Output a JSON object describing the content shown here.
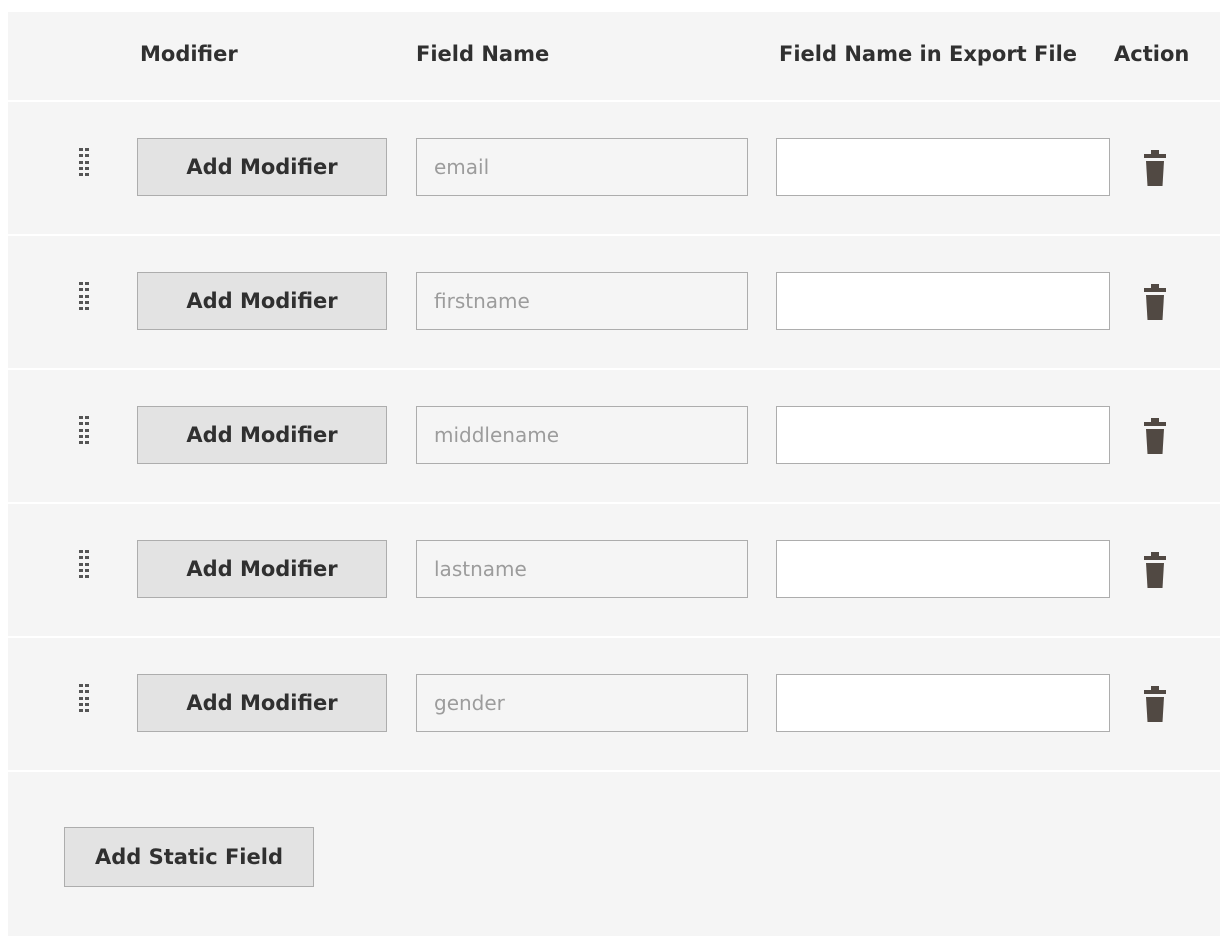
{
  "table": {
    "headers": {
      "modifier": "Modifier",
      "field_name": "Field Name",
      "export_name": "Field Name in Export File",
      "action": "Action"
    },
    "rows": [
      {
        "modifier_label": "Add Modifier",
        "field_value": "email",
        "export_value": ""
      },
      {
        "modifier_label": "Add Modifier",
        "field_value": "firstname",
        "export_value": ""
      },
      {
        "modifier_label": "Add Modifier",
        "field_value": "middlename",
        "export_value": ""
      },
      {
        "modifier_label": "Add Modifier",
        "field_value": "lastname",
        "export_value": ""
      },
      {
        "modifier_label": "Add Modifier",
        "field_value": "gender",
        "export_value": ""
      }
    ]
  },
  "footer": {
    "add_static_label": "Add Static Field"
  },
  "icons": {
    "drag": "drag-handle-icon",
    "delete": "trash-icon"
  },
  "colors": {
    "panel_bg": "#f5f5f5",
    "button_bg": "#e3e3e3",
    "text": "#303030",
    "placeholder": "#9c9c9c",
    "icon": "#514943"
  }
}
